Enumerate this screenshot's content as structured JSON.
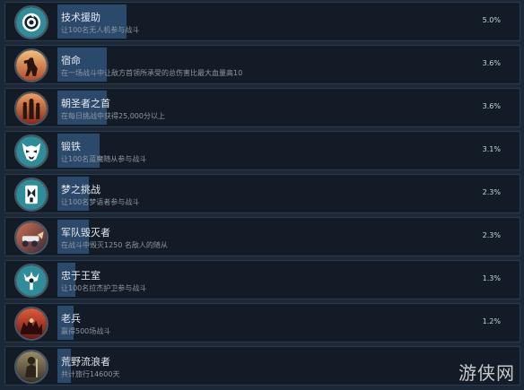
{
  "achievements": [
    {
      "title": "技术援助",
      "desc": "让100名无人机参与战斗",
      "percent": "5.0%",
      "progress": 0.05,
      "icon": "radar-target-icon",
      "icon_bg": "#2f8d99"
    },
    {
      "title": "宿命",
      "desc": "在一场战斗中让敌方首领所承受的总伤害比最大血量高10",
      "percent": "3.6%",
      "progress": 0.036,
      "icon": "warrior-sunset-icon",
      "icon_bg": "#c8673a"
    },
    {
      "title": "朝圣者之首",
      "desc": "在每日挑战中获得25,000分以上",
      "percent": "3.6%",
      "progress": 0.036,
      "icon": "pilgrims-sunset-icon",
      "icon_bg": "#c0542f"
    },
    {
      "title": "锻铁",
      "desc": "让100名蓝魔随从参与战斗",
      "percent": "3.1%",
      "progress": 0.031,
      "icon": "demon-mask-icon",
      "icon_bg": "#2f8d99"
    },
    {
      "title": "梦之挑战",
      "desc": "让100名梦语者参与战斗",
      "percent": "2.3%",
      "progress": 0.023,
      "icon": "mirror-glyph-icon",
      "icon_bg": "#2f8d99"
    },
    {
      "title": "军队毁灭者",
      "desc": "在战斗中毁灭1250 名敌人的随从",
      "percent": "2.3%",
      "progress": 0.023,
      "icon": "cannon-destroyer-icon",
      "icon_bg": "#b8483a"
    },
    {
      "title": "忠于王室",
      "desc": "让100名拉杰护卫参与战斗",
      "percent": "1.3%",
      "progress": 0.013,
      "icon": "royal-trident-icon",
      "icon_bg": "#2f8d99"
    },
    {
      "title": "老兵",
      "desc": "赢得500场战斗",
      "percent": "1.2%",
      "progress": 0.012,
      "icon": "veteran-horde-icon",
      "icon_bg": "#b8352a"
    },
    {
      "title": "荒野流浪者",
      "desc": "共计旅行14600天",
      "percent": "",
      "progress": 0.01,
      "icon": "wanderer-figure-icon",
      "icon_bg": "#6b6252"
    }
  ],
  "watermark": "游侠网"
}
